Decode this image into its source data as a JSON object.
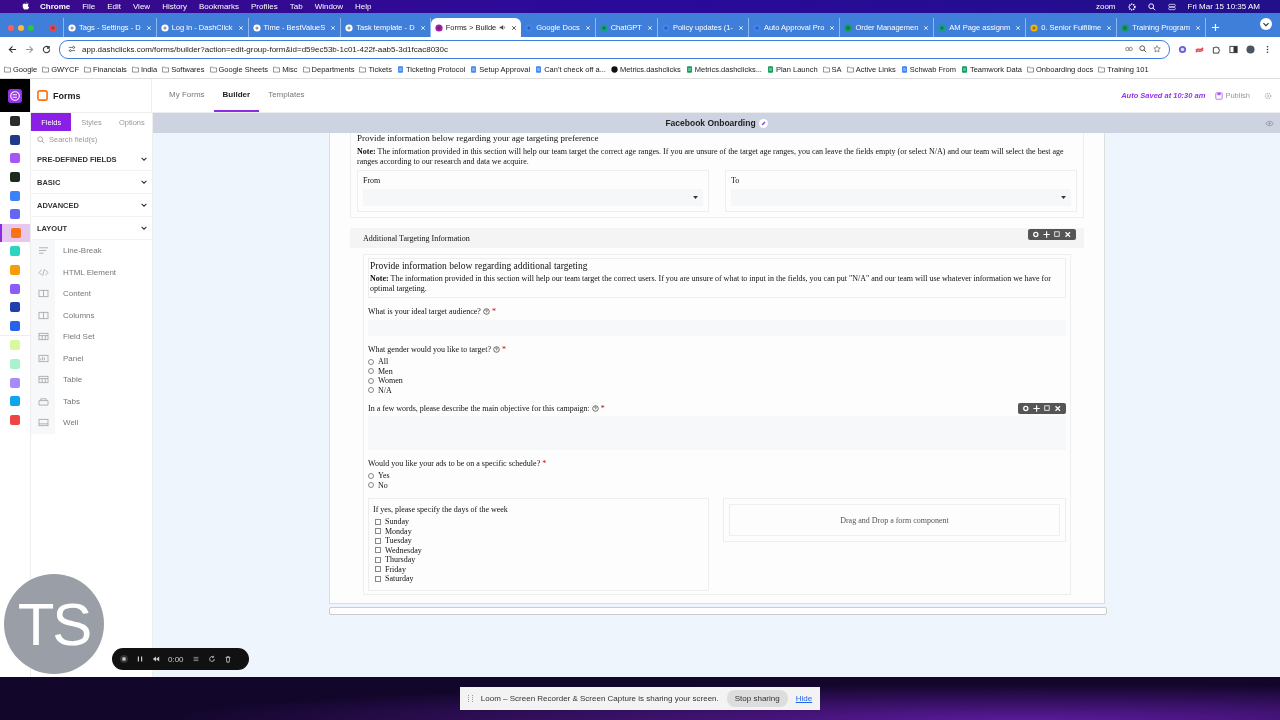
{
  "menubar": {
    "app": "Chrome",
    "menus": [
      "File",
      "Edit",
      "View",
      "History",
      "Bookmarks",
      "Profiles",
      "Tab",
      "Window",
      "Help"
    ],
    "zoom": "zoom",
    "clock": "Fri Mar 15  10:35 AM"
  },
  "browser_tabs": [
    {
      "kind": "pinned",
      "selected": false,
      "audio": false
    },
    {
      "title": "Tags - Settings - D",
      "kind": "site",
      "selected": false,
      "audio": false
    },
    {
      "title": "Log in - DashClick",
      "kind": "site",
      "selected": false,
      "audio": false
    },
    {
      "title": "Time - BestValueS",
      "kind": "site",
      "selected": false,
      "audio": false
    },
    {
      "title": "Task template - D",
      "kind": "site",
      "selected": false,
      "audio": false
    },
    {
      "title": "Forms > Builde",
      "kind": "forms",
      "selected": true,
      "audio": true
    },
    {
      "title": "Google Docs",
      "kind": "doc",
      "selected": false,
      "audio": false
    },
    {
      "title": "ChatGPT",
      "kind": "chat",
      "selected": false,
      "audio": false
    },
    {
      "title": "Policy updates (1-",
      "kind": "doc",
      "selected": false,
      "audio": false
    },
    {
      "title": "Auto Approval Pro",
      "kind": "doc",
      "selected": false,
      "audio": false
    },
    {
      "title": "Order Managemen",
      "kind": "sheet",
      "selected": false,
      "audio": false
    },
    {
      "title": "AM Page assignm",
      "kind": "chat",
      "selected": false,
      "audio": false
    },
    {
      "title": "0. Senior Fulfillme",
      "kind": "drive",
      "selected": false,
      "audio": false
    },
    {
      "title": "Training Program",
      "kind": "sheet",
      "selected": false,
      "audio": false
    }
  ],
  "url": "app.dashclicks.com/forms/builder?action=edit-group-form&id=d59ec53b-1c01-422f-aab5-3d1fcac8030c",
  "bookmarks": [
    {
      "label": "Google",
      "kind": "folder"
    },
    {
      "label": "GWYCF",
      "kind": "folder"
    },
    {
      "label": "Financials",
      "kind": "folder"
    },
    {
      "label": "India",
      "kind": "folder"
    },
    {
      "label": "Softwares",
      "kind": "folder"
    },
    {
      "label": "Google Sheets",
      "kind": "folder"
    },
    {
      "label": "Misc",
      "kind": "folder"
    },
    {
      "label": "Departments",
      "kind": "folder"
    },
    {
      "label": "Tickets",
      "kind": "folder"
    },
    {
      "label": "Ticketing Protocol",
      "kind": "doc"
    },
    {
      "label": "Setup Approval",
      "kind": "doc"
    },
    {
      "label": "Can't check off a...",
      "kind": "doc"
    },
    {
      "label": "Metrics.dashclicks",
      "kind": "site"
    },
    {
      "label": "Metrics.dashclicks...",
      "kind": "sheet"
    },
    {
      "label": "Plan Launch",
      "kind": "sheet"
    },
    {
      "label": "SA",
      "kind": "folder"
    },
    {
      "label": "Active Links",
      "kind": "folder"
    },
    {
      "label": "Schwab From",
      "kind": "web"
    },
    {
      "label": "Teamwork Data",
      "kind": "sheet"
    },
    {
      "label": "Onboarding docs",
      "kind": "folder"
    },
    {
      "label": "Training 101",
      "kind": "folder"
    }
  ],
  "rail": [
    {
      "color": "#2b2b2b",
      "selected": false
    },
    {
      "color": "#1e3a8a",
      "selected": false
    },
    {
      "color": "#a855f7",
      "selected": false
    },
    {
      "color": "#1f2a1f",
      "selected": false
    },
    {
      "color": "#3b82f6",
      "selected": false
    },
    {
      "color": "#6366f1",
      "selected": false
    },
    {
      "color": "#f97316",
      "selected": true
    },
    {
      "color": "#2dd4bf",
      "selected": false
    },
    {
      "color": "#f59e0b",
      "selected": false
    },
    {
      "color": "#8b5cf6",
      "selected": false
    },
    {
      "color": "#1e40af",
      "selected": false
    },
    {
      "color": "#2563eb",
      "selected": false
    },
    {
      "color": "#d9f99d",
      "selected": false
    },
    {
      "color": "#a7f3d0",
      "selected": false
    },
    {
      "color": "#a78bfa",
      "selected": false
    },
    {
      "color": "#0ea5e9",
      "selected": false
    },
    {
      "color": "#ef4444",
      "selected": false
    }
  ],
  "app": {
    "brand": "Forms",
    "nav": [
      {
        "label": "My Forms",
        "selected": false
      },
      {
        "label": "Builder",
        "selected": true
      },
      {
        "label": "Templates",
        "selected": false
      }
    ],
    "autosave": "Auto Saved at 10:30 am",
    "publish": "Publish",
    "form_title": "Facebook Onboarding"
  },
  "panel": {
    "tabs": [
      {
        "label": "Fields",
        "selected": true
      },
      {
        "label": "Styles",
        "selected": false
      },
      {
        "label": "Options",
        "selected": false
      }
    ],
    "search_placeholder": "Search field(s)",
    "sections": [
      {
        "label": "PRE-DEFINED FIELDS"
      },
      {
        "label": "BASIC"
      },
      {
        "label": "ADVANCED"
      },
      {
        "label": "LAYOUT",
        "items": [
          {
            "label": "Line-Break",
            "kind": "linebreak"
          },
          {
            "label": "HTML Element",
            "kind": "html"
          },
          {
            "label": "Content",
            "kind": "content"
          },
          {
            "label": "Columns",
            "kind": "columns"
          },
          {
            "label": "Field Set",
            "kind": "fieldset"
          },
          {
            "label": "Panel",
            "kind": "panel"
          },
          {
            "label": "Table",
            "kind": "table"
          },
          {
            "label": "Tabs",
            "kind": "tabs"
          },
          {
            "label": "Well",
            "kind": "well"
          }
        ]
      }
    ]
  },
  "form": {
    "age_section": {
      "heading": "Provide information below regarding your age targeting preference",
      "note": "**Note:** The information provided in this section will help our team target the correct age ranges. If you are unsure of the target age ranges, you can leave the fields empty (or select N/A) and our team will select the best age ranges according to our research and data we acquire.",
      "selects": [
        {
          "label": "From"
        },
        {
          "label": "To"
        }
      ]
    },
    "panel": {
      "title": "Additional Targeting Information",
      "toolbar": true,
      "heading": "Provide information below regarding additional targeting",
      "note": "**Note:** The information provided in this section will help our team target the correct users. If you are unsure of what to input in the fields, you can put \"N/A\" and our team will use whatever information we have for optimal targeting.",
      "fields": [
        {
          "kind": "text",
          "label": "What is your ideal target audience?",
          "help": true,
          "required_mark": "*",
          "toolbar": false
        },
        {
          "kind": "radio",
          "label": "What gender would you like to target?",
          "help": true,
          "required_mark": "*",
          "toolbar": false,
          "options": [
            {
              "label": "All",
              "selected": false
            },
            {
              "label": "Men",
              "selected": false
            },
            {
              "label": "Women",
              "selected": false
            },
            {
              "label": "N/A",
              "selected": false
            }
          ]
        },
        {
          "kind": "textarea",
          "label": "In a few words, please describe the main objective for this campaign:",
          "help": true,
          "required_mark": "*",
          "toolbar": true
        },
        {
          "kind": "radio",
          "label": "Would you like your ads to be on a specific schedule?",
          "help": false,
          "required_mark": "*",
          "toolbar": false,
          "options": [
            {
              "label": "Yes",
              "selected": false
            },
            {
              "label": "No",
              "selected": false
            }
          ]
        },
        {
          "kind": "columns",
          "label": "If yes, please specify the days of the week",
          "toolbar": false,
          "options": [
            {
              "label": "Sunday",
              "checked": false
            },
            {
              "label": "Monday",
              "checked": false
            },
            {
              "label": "Tuesday",
              "checked": false
            },
            {
              "label": "Wednesday",
              "checked": false
            },
            {
              "label": "Thursday",
              "checked": false
            },
            {
              "label": "Friday",
              "checked": false
            },
            {
              "label": "Saturday",
              "checked": false
            }
          ],
          "dropzone": "Drag and Drop a form component"
        }
      ]
    }
  },
  "overlays": {
    "avatar_initials": "TS",
    "recorder_time": "0:00",
    "loom_message": "Loom – Screen Recorder & Screen Capture is sharing your screen.",
    "stop_button": "Stop sharing",
    "hide_link": "Hide"
  }
}
